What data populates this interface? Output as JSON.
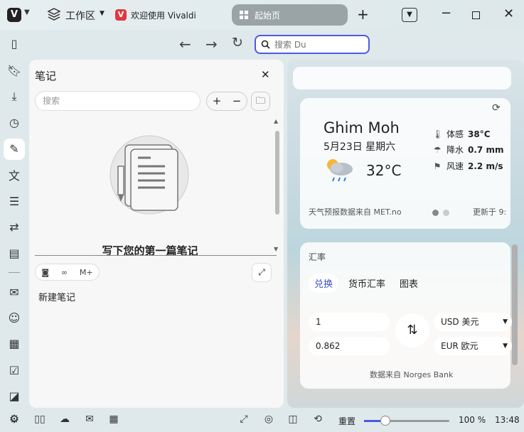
{
  "titlebar": {
    "workspace_label": "工作区",
    "tabs": [
      {
        "title": "欢迎使用 Vivaldi",
        "icon": "vivaldi-icon"
      },
      {
        "title": "起始页",
        "icon": "speed-dial-icon"
      }
    ],
    "new_tab": "+"
  },
  "address": {
    "search_placeholder": "搜索 Du",
    "search_value": "搜索 Du"
  },
  "sidebar": {
    "items": [
      "panel-toggle-icon",
      "bookmarks-icon",
      "downloads-icon",
      "history-icon",
      "notes-icon",
      "translate-icon",
      "reading-list-icon",
      "sync-icon",
      "window-icon",
      "mail-icon",
      "contacts-icon",
      "calendar-icon",
      "tasks-icon",
      "feeds-icon",
      "settings-icon"
    ],
    "active": "notes-icon"
  },
  "notes_panel": {
    "title": "笔记",
    "search_placeholder": "搜索",
    "add": "+",
    "remove": "−",
    "empty_message": "写下您的第一篇笔记",
    "markdown_label": "M+",
    "new_note": "新建笔记"
  },
  "start_page": {
    "weather": {
      "city": "Ghim Moh",
      "date": "5月23日 星期六",
      "temperature": "32°C",
      "feels_like_label": "体感",
      "feels_like": "38°C",
      "precip_label": "降水",
      "precip": "0.7 mm",
      "wind_label": "风速",
      "wind": "2.2 m/s",
      "source": "天气预报数据来自 MET.no",
      "updated": "更新于 9:"
    },
    "currency": {
      "title": "汇率",
      "tabs": [
        "兑换",
        "货币汇率",
        "图表"
      ],
      "active_tab": "兑换",
      "amount_from": "1",
      "amount_to": "0.862",
      "currency_from": "USD 美元",
      "currency_to": "EUR 欧元",
      "source": "数据来自 Norges Bank"
    }
  },
  "statusbar": {
    "reset_label": "重置",
    "zoom": "100 %",
    "zoom_level": 0.25,
    "time": "13:48"
  },
  "colors": {
    "accent": "#4b5ae6",
    "active_tab": "#9aa4a7",
    "vivaldi_red": "#e0383e"
  }
}
